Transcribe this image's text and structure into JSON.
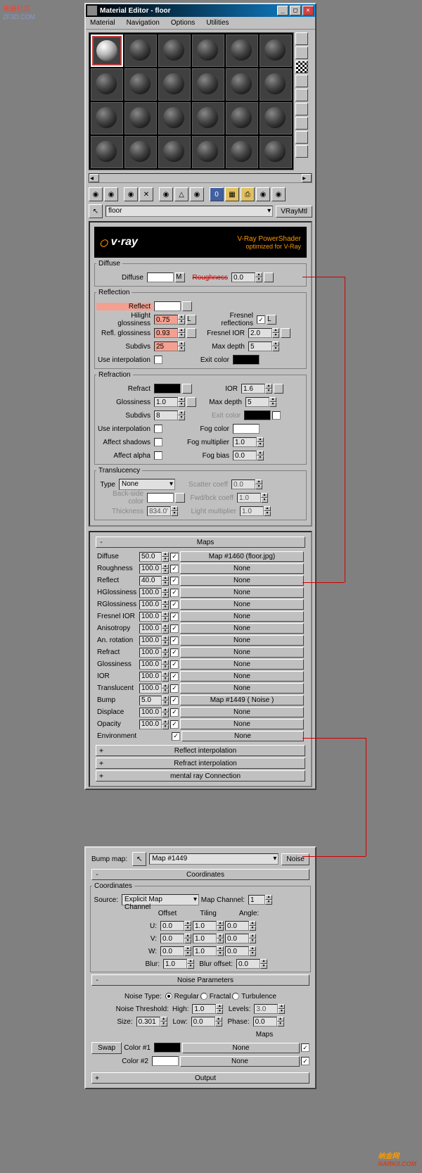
{
  "watermark_tl": {
    "line1": "朱峰社区",
    "line2": "ZF3D.COM"
  },
  "watermark_br": {
    "line1": "纳金网",
    "line2": "NARKII.COM"
  },
  "window": {
    "title": "Material Editor - floor",
    "menus": [
      "Material",
      "Navigation",
      "Options",
      "Utilities"
    ],
    "material_name": "floor",
    "material_type": "VRayMtl"
  },
  "vray": {
    "title": "V-Ray PowerShader",
    "subtitle": "optimized for V-Ray"
  },
  "diffuse": {
    "label": "Diffuse",
    "diffuse_lbl": "Diffuse",
    "m": "M",
    "rough_lbl": "Roughness",
    "rough_val": "0.0"
  },
  "reflection": {
    "label": "Reflection",
    "reflect_lbl": "Reflect",
    "hg_lbl": "Hilight glossiness",
    "hg_val": "0.75",
    "l1": "L",
    "rg_lbl": "Refl. glossiness",
    "rg_val": "0.93",
    "sd_lbl": "Subdivs",
    "sd_val": "25",
    "ui_lbl": "Use interpolation",
    "fr_lbl": "Fresnel reflections",
    "fr_chk": "✓",
    "l2": "L",
    "fior_lbl": "Fresnel IOR",
    "fior_val": "2.0",
    "md_lbl": "Max depth",
    "md_val": "5",
    "ec_lbl": "Exit color"
  },
  "refraction": {
    "label": "Refraction",
    "refract_lbl": "Refract",
    "ior_lbl": "IOR",
    "ior_val": "1.6",
    "gloss_lbl": "Glossiness",
    "gloss_val": "1.0",
    "md_lbl": "Max depth",
    "md_val": "5",
    "sd_lbl": "Subdivs",
    "sd_val": "8",
    "ec_lbl": "Exit color",
    "ui_lbl": "Use interpolation",
    "fc_lbl": "Fog color",
    "as_lbl": "Affect shadows",
    "fm_lbl": "Fog multiplier",
    "fm_val": "1.0",
    "aa_lbl": "Affect alpha",
    "fb_lbl": "Fog bias",
    "fb_val": "0.0"
  },
  "translucency": {
    "label": "Translucency",
    "type_lbl": "Type",
    "type_val": "None",
    "sc_lbl": "Scatter coeff",
    "sc_val": "0.0",
    "bsc_lbl": "Back-side color",
    "fbc_lbl": "Fwd/bck coeff",
    "fbc_val": "1.0",
    "th_lbl": "Thickness",
    "th_val": "834.0'",
    "lm_lbl": "Light multiplier",
    "lm_val": "1.0"
  },
  "maps_hdr": "Maps",
  "maps": [
    {
      "label": "Diffuse",
      "amount": "50.0",
      "on": "✓",
      "map": "Map #1460 (floor.jpg)"
    },
    {
      "label": "Roughness",
      "amount": "100.0",
      "on": "✓",
      "map": "None"
    },
    {
      "label": "Reflect",
      "amount": "40.0",
      "on": "✓",
      "map": "None"
    },
    {
      "label": "HGlossiness",
      "amount": "100.0",
      "on": "✓",
      "map": "None"
    },
    {
      "label": "RGlossiness",
      "amount": "100.0",
      "on": "✓",
      "map": "None"
    },
    {
      "label": "Fresnel IOR",
      "amount": "100.0",
      "on": "✓",
      "map": "None"
    },
    {
      "label": "Anisotropy",
      "amount": "100.0",
      "on": "✓",
      "map": "None"
    },
    {
      "label": "An. rotation",
      "amount": "100.0",
      "on": "✓",
      "map": "None"
    },
    {
      "label": "Refract",
      "amount": "100.0",
      "on": "✓",
      "map": "None"
    },
    {
      "label": "Glossiness",
      "amount": "100.0",
      "on": "✓",
      "map": "None"
    },
    {
      "label": "IOR",
      "amount": "100.0",
      "on": "✓",
      "map": "None"
    },
    {
      "label": "Translucent",
      "amount": "100.0",
      "on": "✓",
      "map": "None"
    },
    {
      "label": "Bump",
      "amount": "5.0",
      "on": "✓",
      "map": "Map #1449  ( Noise )"
    },
    {
      "label": "Displace",
      "amount": "100.0",
      "on": "✓",
      "map": "None"
    },
    {
      "label": "Opacity",
      "amount": "100.0",
      "on": "✓",
      "map": "None"
    },
    {
      "label": "Environment",
      "amount": "",
      "on": "✓",
      "map": "None"
    }
  ],
  "rollouts": [
    "Reflect interpolation",
    "Refract interpolation",
    "mental ray Connection"
  ],
  "bump_map": {
    "lbl": "Bump map:",
    "name": "Map #1449",
    "type": "Noise"
  },
  "coords": {
    "hdr": "Coordinates",
    "fs": "Coordinates",
    "src_lbl": "Source:",
    "src_val": "Explicit Map Channel",
    "mc_lbl": "Map Channel:",
    "mc_val": "1",
    "offset": "Offset",
    "tiling": "Tiling",
    "angle": "Angle:",
    "u": "U:",
    "v": "V:",
    "w": "W:",
    "uo": "0.0",
    "vt": "0.0",
    "wt": "0.0",
    "ut": "1.0",
    "vt2": "1.0",
    "wt2": "1.0",
    "ua": "0.0",
    "va": "0.0",
    "wa": "0.0",
    "blur_lbl": "Blur:",
    "blur_val": "1.0",
    "bo_lbl": "Blur offset:",
    "bo_val": "0.0"
  },
  "noise": {
    "hdr": "Noise Parameters",
    "nt_lbl": "Noise Type:",
    "regular": "Regular",
    "fractal": "Fractal",
    "turb": "Turbulence",
    "thr_lbl": "Noise Threshold:",
    "hi_lbl": "High:",
    "hi_val": "1.0",
    "lv_lbl": "Levels:",
    "lv_val": "3.0",
    "sz_lbl": "Size:",
    "sz_val": "0.301",
    "lo_lbl": "Low:",
    "lo_val": "0.0",
    "ph_lbl": "Phase:",
    "ph_val": "0.0",
    "maps_lbl": "Maps",
    "swap": "Swap",
    "c1_lbl": "Color #1",
    "c1_map": "None",
    "c2_lbl": "Color #2",
    "c2_map": "None"
  },
  "output_hdr": "Output"
}
